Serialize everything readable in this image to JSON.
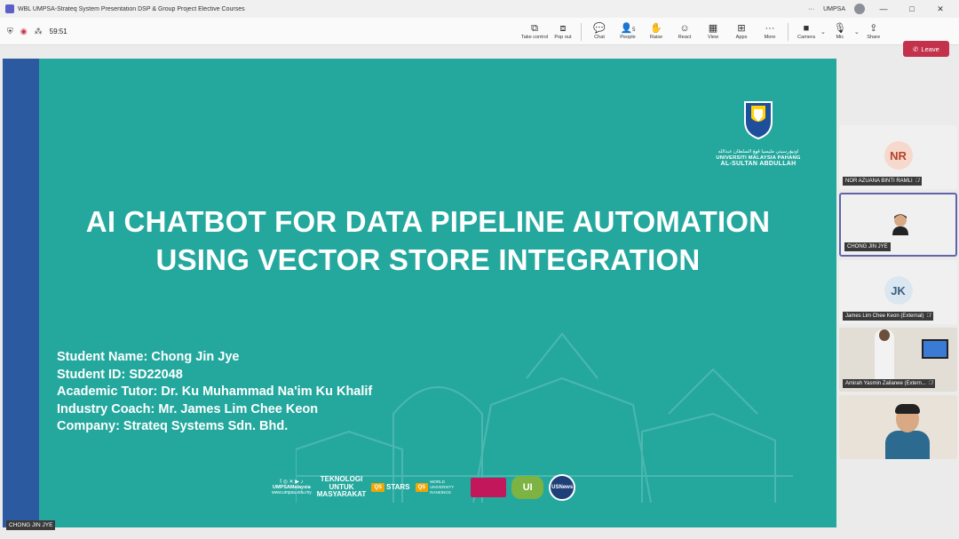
{
  "window": {
    "title": "WBL UMPSA-Strateq System Presentation DSP & Group Project Elective Courses",
    "org": "UMPSA",
    "more": "···",
    "controls": [
      "—",
      "□",
      "✕"
    ]
  },
  "toolbar": {
    "timer": "59:51",
    "items": [
      {
        "label": "Take control",
        "icon": "⧉"
      },
      {
        "label": "Pop out",
        "icon": "⧈"
      },
      {
        "label": "Chat",
        "icon": "💬"
      },
      {
        "label": "People",
        "icon": "👤",
        "count": "5"
      },
      {
        "label": "Raise",
        "icon": "✋"
      },
      {
        "label": "React",
        "icon": "☺"
      },
      {
        "label": "View",
        "icon": "▦"
      },
      {
        "label": "Apps",
        "icon": "⊞"
      },
      {
        "label": "More",
        "icon": "···"
      },
      {
        "label": "Camera",
        "icon": "■"
      },
      {
        "label": "Mic",
        "icon": "🎙"
      },
      {
        "label": "Share",
        "icon": "⇪"
      }
    ],
    "leave_label": "Leave"
  },
  "slide": {
    "title_line1": "AI CHATBOT FOR DATA PIPELINE AUTOMATION",
    "title_line2": "USING VECTOR STORE INTEGRATION",
    "details": [
      "Student Name: Chong Jin Jye",
      "Student ID: SD22048",
      "Academic Tutor: Dr. Ku Muhammad Na'im Ku Khalif",
      "Industry Coach: Mr. James Lim Chee Keon",
      "Company: Strateq Systems Sdn. Bhd."
    ],
    "university": {
      "jawi": "اونيۏرسيتي مليسيا ڤهڠ السلطان عبدالله",
      "name_line1": "UNIVERSITI MALAYSIA PAHANG",
      "name_line2": "AL-SULTAN ABDULLAH"
    },
    "footer_logos": {
      "social_handle": "UMPSAMalaysia",
      "website": "www.umpsa.edu.my",
      "tagline": [
        "TEKNOLOGI",
        "UNTUK",
        "MASYARAKAT"
      ],
      "stars": "STARS",
      "qs": "QS",
      "wur": "WORLD UNIVERSITY RANKINGS",
      "usnews": "USNews"
    }
  },
  "presenter_name": "CHONG JIN JYE",
  "participants": [
    {
      "initials": "NR",
      "name": "NOR AZUANA BINTI RAMLI",
      "muted": true
    },
    {
      "initials": "",
      "name": "CHONG JIN JYE",
      "muted": false
    },
    {
      "initials": "JK",
      "name": "James Lim Chee Keon (External)",
      "muted": true
    },
    {
      "initials": "",
      "name": "Amirah Yasmin Zailanee (Extern...",
      "muted": true
    },
    {
      "initials": "",
      "name": "",
      "muted": false
    }
  ]
}
